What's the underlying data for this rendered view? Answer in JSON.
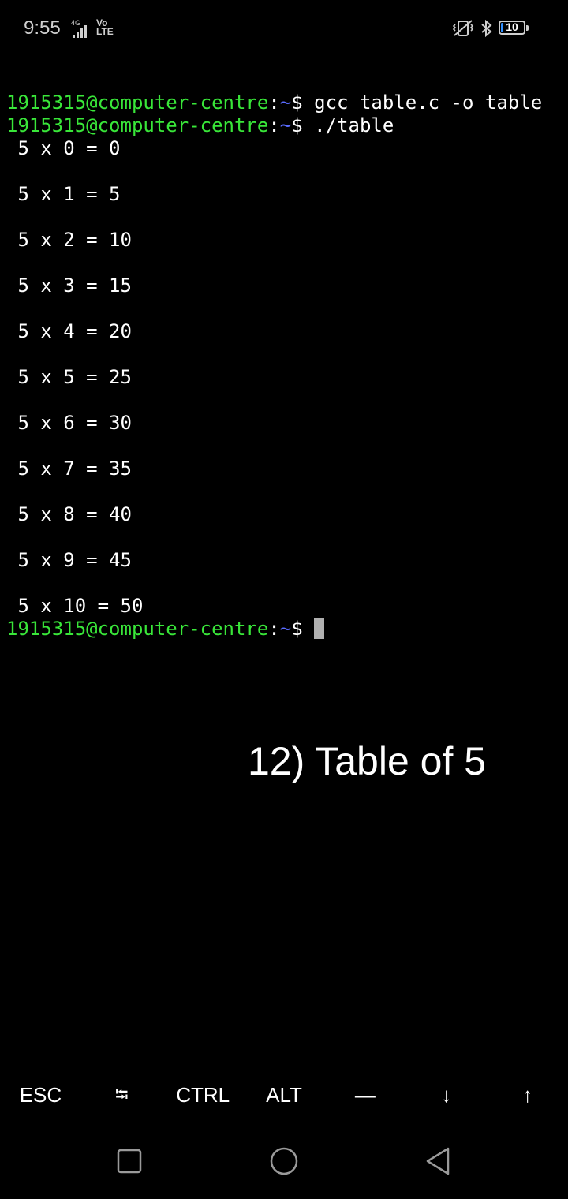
{
  "status_bar": {
    "time": "9:55",
    "network_type": "4G",
    "volte_label": "Vo\nLTE",
    "battery_level": "10",
    "battery_fraction": 0.1,
    "icons": [
      "signal-icon",
      "vibrate-icon",
      "bluetooth-icon",
      "battery-icon"
    ]
  },
  "terminal": {
    "prompt_user": "1915315@computer-centre",
    "prompt_colon": ":",
    "prompt_dir": "~",
    "prompt_symbol": "$ ",
    "commands": [
      "gcc table.c -o table",
      "./table"
    ],
    "output": [
      " 5 x 0 = 0",
      "",
      " 5 x 1 = 5",
      "",
      " 5 x 2 = 10",
      "",
      " 5 x 3 = 15",
      "",
      " 5 x 4 = 20",
      "",
      " 5 x 5 = 25",
      "",
      " 5 x 6 = 30",
      "",
      " 5 x 7 = 35",
      "",
      " 5 x 8 = 40",
      "",
      " 5 x 9 = 45",
      "",
      " 5 x 10 = 50"
    ]
  },
  "caption": "12) Table of 5",
  "extra_keys": [
    {
      "label": "ESC",
      "name": "esc-key"
    },
    {
      "label": "⭾",
      "name": "tab-key"
    },
    {
      "label": "CTRL",
      "name": "ctrl-key"
    },
    {
      "label": "ALT",
      "name": "alt-key"
    },
    {
      "label": "—",
      "name": "dash-key"
    },
    {
      "label": "↓",
      "name": "down-arrow-key"
    },
    {
      "label": "↑",
      "name": "up-arrow-key"
    }
  ],
  "colors": {
    "prompt_user": "#39e639",
    "prompt_dir": "#5a6cff",
    "background": "#000000",
    "battery_accent": "#2f8fff"
  }
}
